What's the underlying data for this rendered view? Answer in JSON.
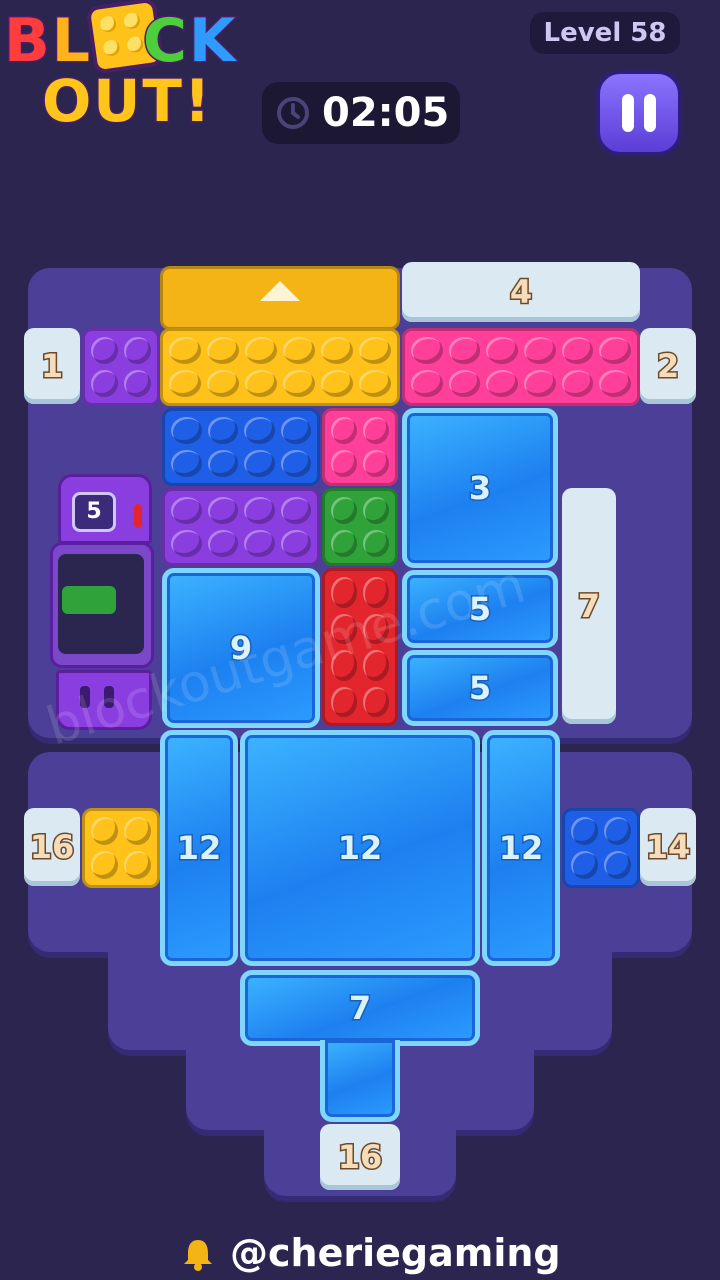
{
  "header": {
    "logo_line1": [
      "B",
      "L",
      "O",
      "C",
      "K"
    ],
    "logo_line2": "OUT!",
    "level": "Level 58",
    "timer": "02:05"
  },
  "colors": {
    "purple": "#8a3ee0",
    "yellow": "#ffc21a",
    "pink": "#ff3f9a",
    "blue": "#1f5ee6",
    "green": "#2fa33a",
    "red": "#e3262d",
    "ice": "#2c9cff"
  },
  "gates": {
    "top": "4",
    "left_top": "1",
    "right_top": "2",
    "right_mid": "7",
    "left_bottom": "16",
    "right_bottom": "14",
    "bottom": "16"
  },
  "ice_blocks": {
    "b3": "3",
    "b5a": "5",
    "b5b": "5",
    "b9": "9",
    "b12_left": "12",
    "b12_center": "12",
    "b12_right": "12",
    "b7_bottom": "7"
  },
  "machine": {
    "counter": "5"
  },
  "watermark": "blockoutgame.com",
  "credit": "@cheriegaming"
}
